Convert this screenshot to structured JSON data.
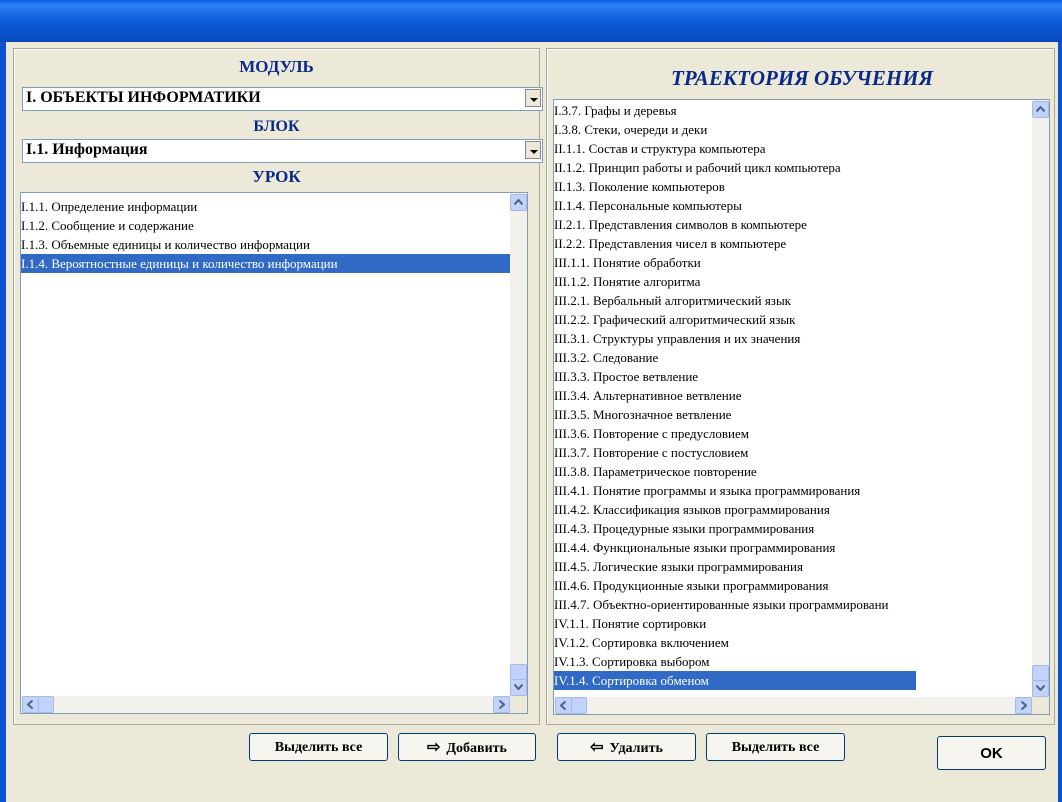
{
  "left": {
    "module_heading": "МОДУЛЬ",
    "module_value": "I. ОБЪЕКТЫ ИНФОРМАТИКИ",
    "block_heading": "БЛОК",
    "block_value": "I.1. Информация",
    "lesson_heading": "УРОК",
    "lessons": [
      "I.1.1. Определение информации",
      "I.1.2. Сообщение и содержание",
      "I.1.3. Объемные единицы и количество информации",
      "I.1.4. Вероятностные единицы и количество информации"
    ],
    "selected_lesson": 3
  },
  "right": {
    "heading": "ТРАЕКТОРИЯ ОБУЧЕНИЯ",
    "items": [
      "I.3.7. Графы и деревья",
      "I.3.8. Стеки, очереди и деки",
      "II.1.1. Состав и структура компьютера",
      "II.1.2. Принцип работы и рабочий цикл компьютера",
      "II.1.3. Поколение компьютеров",
      "II.1.4. Персональные компьютеры",
      "II.2.1. Представления символов в компьютере",
      "II.2.2. Представления чисел в компьютере",
      "III.1.1. Понятие обработки",
      "III.1.2. Понятие алгоритма",
      "III.2.1. Вербальный алгоритмический язык",
      "III.2.2. Графический алгоритмический язык",
      "III.3.1. Структуры управления и их значения",
      "III.3.2. Следование",
      "III.3.3. Простое ветвление",
      "III.3.4. Альтернативное ветвление",
      "III.3.5. Многозначное ветвление",
      "III.3.6. Повторение с предусловием",
      "III.3.7. Повторение с постусловием",
      "III.3.8. Параметрическое повторение",
      "III.4.1. Понятие программы и языка программирования",
      "III.4.2. Классификация языков программирования",
      "III.4.3. Процедурные языки программирования",
      "III.4.4. Функциональные языки программирования",
      "III.4.5. Логические языки программирования",
      "III.4.6. Продукционные языки программирования",
      "III.4.7. Объектно-ориентированные языки программировани",
      "IV.1.1. Понятие сортировки",
      "IV.1.2. Сортировка включением",
      "IV.1.3. Сортировка выбором",
      "IV.1.4. Сортировка обменом"
    ],
    "selected_item": 30
  },
  "buttons": {
    "select_all_left": "Выделить все",
    "add": "Добавить",
    "remove": "Удалить",
    "select_all_right": "Выделить все",
    "ok": "OK"
  },
  "colors": {
    "selection": "#316AC5",
    "heading": "#0A2A8A",
    "titlebar": "#0A52D0"
  }
}
